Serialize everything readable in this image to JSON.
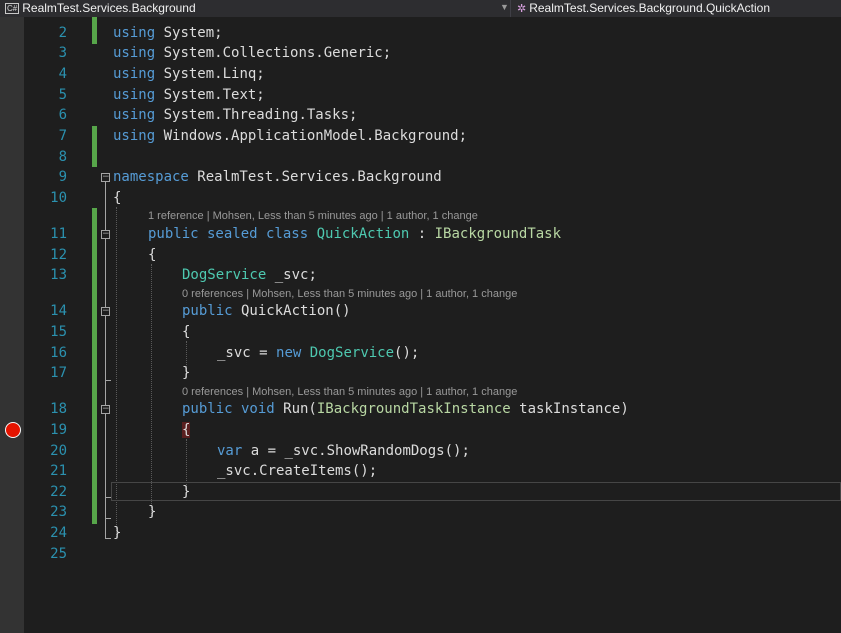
{
  "nav_bar": {
    "left_dropdown": "RealmTest.Services.Background",
    "right_dropdown": "RealmTest.Services.Background.QuickAction",
    "left_icon": "csharp-project-icon",
    "right_icon": "class-icon"
  },
  "editor": {
    "line_numbers": [
      "2",
      "3",
      "4",
      "5",
      "6",
      "7",
      "8",
      "9",
      "10",
      "11",
      "12",
      "13",
      "14",
      "15",
      "16",
      "17",
      "18",
      "19",
      "20",
      "21",
      "22",
      "23",
      "24",
      "25"
    ],
    "breakpoint_line": "19",
    "code": {
      "l2_kw": "using",
      "l2_rest": " System;",
      "l3_kw": "using",
      "l3_rest": " System.Collections.Generic;",
      "l4_kw": "using",
      "l4_rest": " System.Linq;",
      "l5_kw": "using",
      "l5_rest": " System.Text;",
      "l6_kw": "using",
      "l6_rest": " System.Threading.Tasks;",
      "l7_kw": "using",
      "l7_rest": " Windows.ApplicationModel.Background;",
      "l9_kw": "namespace",
      "l9_rest": " RealmTest.Services.Background",
      "l10": "{",
      "l11_kw": "public sealed class",
      "l11_type": "QuickAction",
      "l11_sep": " : ",
      "l11_iface": "IBackgroundTask",
      "l12": "{",
      "l13_type": "DogService",
      "l13_rest": " _svc;",
      "l14_kw": "public",
      "l14_rest": " QuickAction()",
      "l15": "{",
      "l16_pre": "_svc = ",
      "l16_kw": "new",
      "l16_type": "DogService",
      "l16_post": "();",
      "l17": "}",
      "l18_kw": "public void",
      "l18_mid": " Run(",
      "l18_iface": "IBackgroundTaskInstance",
      "l18_post": " taskInstance)",
      "l19": "{",
      "l20_kw": "var",
      "l20_rest": " a = _svc.ShowRandomDogs();",
      "l21": "_svc.CreateItems();",
      "l22": "}",
      "l23": "}",
      "l24": "}"
    },
    "codelens": {
      "class_lens": "1 reference | Mohsen, Less than 5 minutes ago | 1 author, 1 change",
      "ctor_lens": "0 references | Mohsen, Less than 5 minutes ago | 1 author, 1 change",
      "run_lens": "0 references | Mohsen, Less than 5 minutes ago | 1 author, 1 change"
    },
    "colors": {
      "keyword": "#569cd6",
      "type": "#4ec9b0",
      "interface": "#b8d7a3",
      "line_number": "#2b91af",
      "changed_marker": "#57a64a",
      "breakpoint": "#e51400",
      "background": "#1e1e1e"
    }
  }
}
